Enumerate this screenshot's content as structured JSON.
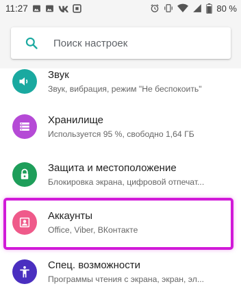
{
  "status_bar": {
    "time": "11:27",
    "battery_percent": "80 %",
    "icons_left": [
      "image-icon",
      "image-icon",
      "vk-icon",
      "square-icon"
    ],
    "icons_right": [
      "alarm-icon",
      "vibrate-icon",
      "wifi-icon",
      "signal-icon",
      "battery-icon"
    ]
  },
  "search": {
    "placeholder": "Поиск настроек"
  },
  "settings": [
    {
      "title": "Звук",
      "subtitle": "Звук, вибрация, режим \"Не беспокоить\"",
      "icon": "volume-icon",
      "color": "#1aa9a0"
    },
    {
      "title": "Хранилище",
      "subtitle": "Используется 95 %, свободно 1,64 ГБ",
      "icon": "storage-icon",
      "color": "#b54ad6"
    },
    {
      "title": "Защита и местоположение",
      "subtitle": "Блокировка экрана, цифровой отпечат...",
      "icon": "lock-icon",
      "color": "#1e9e5a"
    },
    {
      "title": "Аккаунты",
      "subtitle": "Office, Viber, ВКонтакте",
      "icon": "account-icon",
      "color": "#ef5a8a"
    },
    {
      "title": "Спец. возможности",
      "subtitle": "Программы чтения с экрана, экран, эл...",
      "icon": "accessibility-icon",
      "color": "#4a2fc0"
    }
  ],
  "colors": {
    "accent": "#1aa9a0",
    "highlight_border": "#d11ad8"
  }
}
